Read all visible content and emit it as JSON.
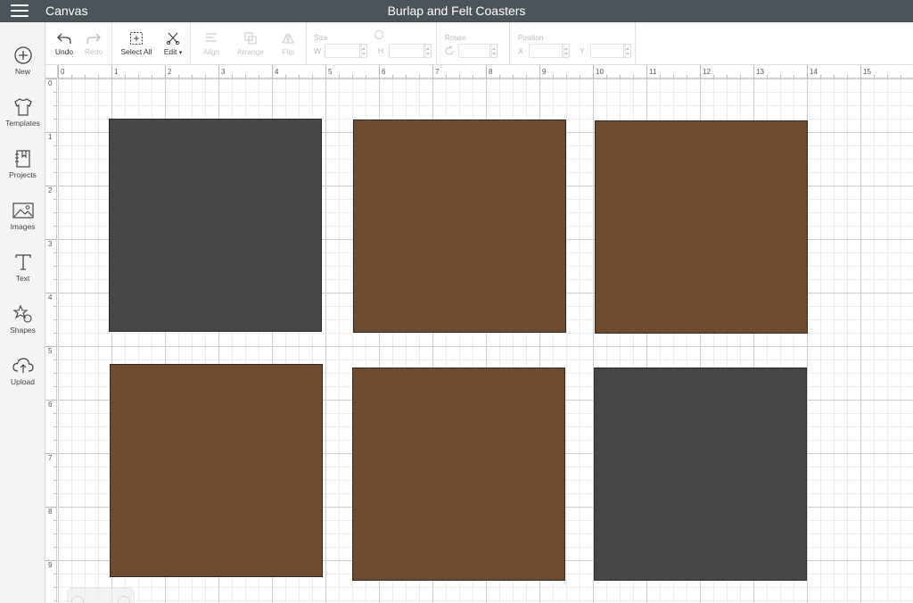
{
  "topbar": {
    "app_name": "Canvas",
    "document_title": "Burlap and Felt Coasters"
  },
  "sidebar": {
    "items": [
      {
        "label": "New",
        "icon": "plus-circle-icon"
      },
      {
        "label": "Templates",
        "icon": "tshirt-icon"
      },
      {
        "label": "Projects",
        "icon": "notebook-icon"
      },
      {
        "label": "Images",
        "icon": "image-icon"
      },
      {
        "label": "Text",
        "icon": "text-t-icon"
      },
      {
        "label": "Shapes",
        "icon": "shapes-icon"
      },
      {
        "label": "Upload",
        "icon": "cloud-upload-icon"
      }
    ]
  },
  "toolbar": {
    "undo_label": "Undo",
    "redo_label": "Redo",
    "select_all_label": "Select All",
    "edit_label": "Edit",
    "align_label": "Align",
    "arrange_label": "Arrange",
    "flip_label": "Flip",
    "size_label": "Size",
    "w_label": "W",
    "h_label": "H",
    "rotate_label": "Rotate",
    "position_label": "Position",
    "x_label": "X",
    "y_label": "Y"
  },
  "ruler": {
    "top_numbers": [
      "0",
      "1",
      "2",
      "3",
      "4",
      "5",
      "6",
      "7",
      "8",
      "9",
      "10",
      "11",
      "12",
      "13",
      "14",
      "15"
    ],
    "left_numbers": [
      "0",
      "1",
      "2",
      "3",
      "4",
      "5",
      "6",
      "7",
      "8",
      "9"
    ]
  },
  "colors": {
    "felt_gray": "#464646",
    "burlap_brown": "#6e4a2f",
    "topbar": "#4a5459"
  },
  "coasters": [
    {
      "name": "coaster-gray-top-left",
      "color": "#464646"
    },
    {
      "name": "coaster-brown-top-middle",
      "color": "#6e4a2f"
    },
    {
      "name": "coaster-brown-top-right",
      "color": "#6e4a2f"
    },
    {
      "name": "coaster-brown-bottom-left",
      "color": "#6e4a2f"
    },
    {
      "name": "coaster-brown-bottom-middle",
      "color": "#6e4a2f"
    },
    {
      "name": "coaster-gray-bottom-right",
      "color": "#464646"
    }
  ]
}
